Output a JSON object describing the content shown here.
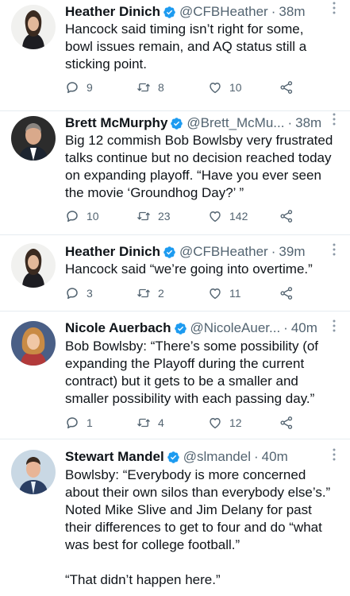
{
  "tweets": [
    {
      "name": "Heather Dinich",
      "handle": "@CFBHeather",
      "time": "38m",
      "text": "Hancock said timing isn’t right for some,\nbowl issues remain, and AQ status still a\nsticking point.",
      "replies": "9",
      "retweets": "8",
      "likes": "10"
    },
    {
      "name": "Brett McMurphy",
      "handle": "@Brett_McMu...",
      "time": "38m",
      "text": "Big 12 commish Bob Bowlsby very frustrated\ntalks continue but no decision reached today\non expanding playoff. “Have you ever seen\nthe movie ‘Groundhog Day?’ ”",
      "replies": "10",
      "retweets": "23",
      "likes": "142"
    },
    {
      "name": "Heather Dinich",
      "handle": "@CFBHeather",
      "time": "39m",
      "text": "Hancock said “we’re going into overtime.”",
      "replies": "3",
      "retweets": "2",
      "likes": "11"
    },
    {
      "name": "Nicole Auerbach",
      "handle": "@NicoleAuer...",
      "time": "40m",
      "text": "Bob Bowlsby: “There’s some possibility (of\nexpanding the Playoff during the current\ncontract) but it gets to be a smaller and\nsmaller possibility with each passing day.”",
      "replies": "1",
      "retweets": "4",
      "likes": "12"
    },
    {
      "name": "Stewart Mandel",
      "handle": "@slmandel",
      "time": "40m",
      "text": "Bowlsby: “Everybody is more concerned\nabout their own silos than everybody else’s.”\nNoted Mike Slive and Jim Delany for past\ntheir differences to get to four and do “what\nwas best for college football.”\n\n“That didn’t happen here.”"
    }
  ],
  "separator": "·",
  "colors": {
    "verified": "#1d9bf0",
    "secondary_text": "#536471",
    "divider": "#e6ecf0"
  },
  "icons": [
    "verified-badge-icon",
    "more-options-icon",
    "reply-icon",
    "retweet-icon",
    "like-icon",
    "share-icon"
  ]
}
